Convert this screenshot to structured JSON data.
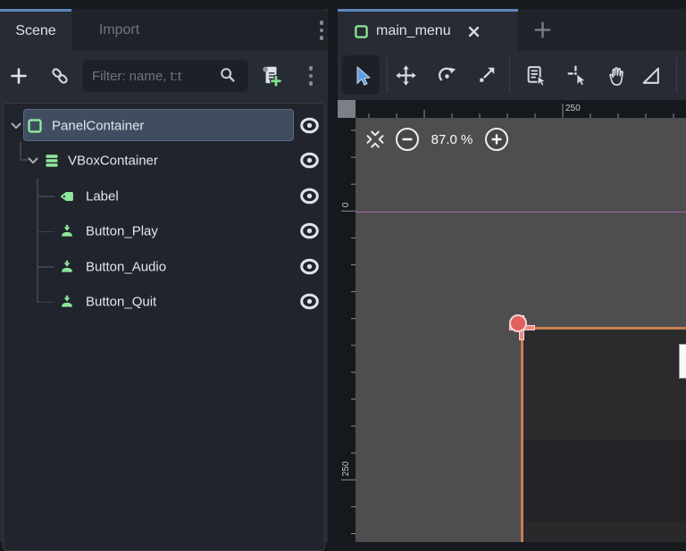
{
  "colors": {
    "accent_blue": "#5d87c0",
    "node_green": "#8de79a",
    "selection_orange": "#c77d4d",
    "guide_purple": "#a96aa9",
    "select_tool_blue": "#5fa0e0"
  },
  "left_dock": {
    "tabs": [
      {
        "label": "Scene",
        "active": true
      },
      {
        "label": "Import",
        "active": false
      }
    ],
    "toolbar_icons": [
      "add-node",
      "instance-scene",
      "filter",
      "attach-script",
      "menu"
    ],
    "filter_placeholder": "Filter: name, t:t",
    "tree": [
      {
        "name": "PanelContainer",
        "icon": "panel-container",
        "depth": 0,
        "selected": true,
        "chevron": true
      },
      {
        "name": "VBoxContainer",
        "icon": "vbox-container",
        "depth": 1,
        "selected": false,
        "chevron": true
      },
      {
        "name": "Label",
        "icon": "label",
        "depth": 2,
        "selected": false,
        "chevron": false
      },
      {
        "name": "Button_Play",
        "icon": "button",
        "depth": 2,
        "selected": false,
        "chevron": false
      },
      {
        "name": "Button_Audio",
        "icon": "button",
        "depth": 2,
        "selected": false,
        "chevron": false
      },
      {
        "name": "Button_Quit",
        "icon": "button",
        "depth": 2,
        "selected": false,
        "chevron": false
      }
    ]
  },
  "main": {
    "scene_tab": {
      "label": "main_menu",
      "icon": "panel-container"
    },
    "toolbar_tools": [
      "select",
      "move",
      "rotate",
      "scale",
      "list-select",
      "change-pivot",
      "pan",
      "ruler"
    ],
    "zoom": {
      "value": "87.0 %"
    },
    "rulers": {
      "h": {
        "start": 15,
        "step": 31,
        "count": 12,
        "medium": [
          2
        ],
        "major": {
          "7": "250"
        }
      },
      "v": {
        "start": 14,
        "step": 30.1,
        "count": 16,
        "medium": [],
        "major": {
          "3": "0",
          "13": "250"
        }
      }
    }
  }
}
